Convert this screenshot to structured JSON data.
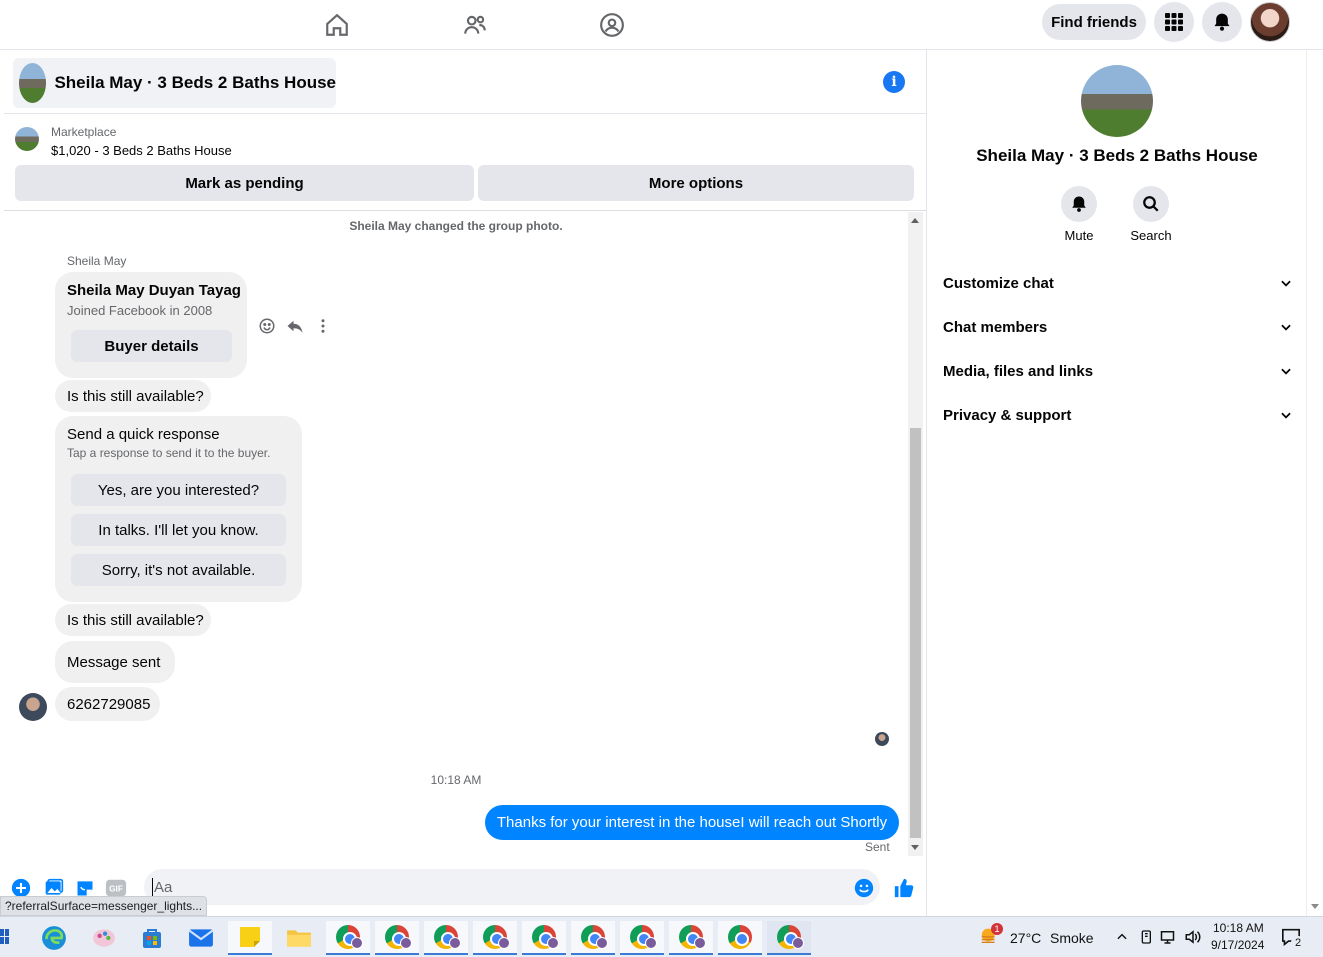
{
  "topnav": {
    "icons": [
      "home-icon",
      "friends-icon",
      "groups-icon"
    ],
    "find_friends": "Find friends",
    "menu_icon": "grid-menu-icon",
    "notifications_icon": "bell-icon"
  },
  "chat": {
    "title": "Sheila May · 3 Beds 2 Baths House",
    "info_glyph": "i"
  },
  "marketplace": {
    "label": "Marketplace",
    "listing": "$1,020 - 3 Beds 2 Baths House",
    "mark_pending": "Mark as pending",
    "more_options": "More options"
  },
  "messages": {
    "system_note": "Sheila May changed the group photo.",
    "sender_name": "Sheila May",
    "profile_card": {
      "name": "Sheila May Duyan Tayag",
      "joined": "Joined Facebook in 2008",
      "button": "Buyer details"
    },
    "still_available_1": "Is this still available?",
    "quick_response": {
      "title": "Send a quick response",
      "subtitle": "Tap a response to send it to the buyer.",
      "options": [
        "Yes, are you interested?",
        "In talks. I'll let you know.",
        "Sorry, it's not available."
      ]
    },
    "still_available_2": "Is this still available?",
    "message_sent": "Message sent",
    "phone": "6262729085",
    "timestamp": "10:18 AM",
    "outgoing": "Thanks for your interest in the houseI will reach out Shortly",
    "status": "Sent"
  },
  "composer": {
    "placeholder": "Aa",
    "status_url": "?referralSurface=messenger_lights...",
    "gif_label": "GIF"
  },
  "right_panel": {
    "title": "Sheila May · 3 Beds 2 Baths House",
    "mute": "Mute",
    "search": "Search",
    "sections": [
      "Customize chat",
      "Chat members",
      "Media, files and links",
      "Privacy & support"
    ]
  },
  "taskbar": {
    "weather_temp": "27°C",
    "weather_desc": "Smoke",
    "weather_badge": "1",
    "time": "10:18 AM",
    "date": "9/17/2024",
    "notification_count": "2"
  },
  "colors": {
    "messenger_blue": "#0084ff",
    "facebook_blue": "#1877f2",
    "bubble_gray": "#f0f0f0"
  }
}
